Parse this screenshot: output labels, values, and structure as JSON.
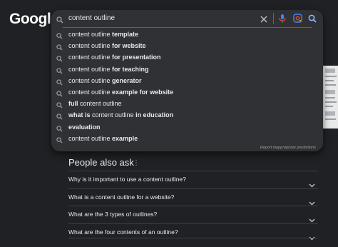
{
  "logo": "Google",
  "search": {
    "query": "content outline",
    "report_text": "Report inappropriate predictions"
  },
  "suggestions": [
    {
      "prefix": "content outline ",
      "bold": "template",
      "suffix": ""
    },
    {
      "prefix": "content outline ",
      "bold": "for website",
      "suffix": ""
    },
    {
      "prefix": "content outline ",
      "bold": "for presentation",
      "suffix": ""
    },
    {
      "prefix": "content outline ",
      "bold": "for teaching",
      "suffix": ""
    },
    {
      "prefix": "content outline ",
      "bold": "generator",
      "suffix": ""
    },
    {
      "prefix": "content outline ",
      "bold": "example for website",
      "suffix": ""
    },
    {
      "prefix": "",
      "bold": "full",
      "suffix": " content outline"
    },
    {
      "prefix": "",
      "bold": "what is",
      "suffix": " content outline "
    },
    {
      "prefix": "",
      "bold": "evaluation",
      "suffix": ""
    },
    {
      "prefix": "content outline ",
      "bold": "example",
      "suffix": ""
    }
  ],
  "suggestion_extra_bold": "in education",
  "people_also_ask": {
    "title": "People also ask",
    "questions": [
      "Why is it important to use a content outline?",
      "What is a content outline for a website?",
      "What are the 3 types of outlines?",
      "What are the four contents of an outline?"
    ]
  },
  "colors": {
    "background": "#202124",
    "panel": "#303134",
    "text": "#e8eaed",
    "muted": "#9aa0a6"
  }
}
